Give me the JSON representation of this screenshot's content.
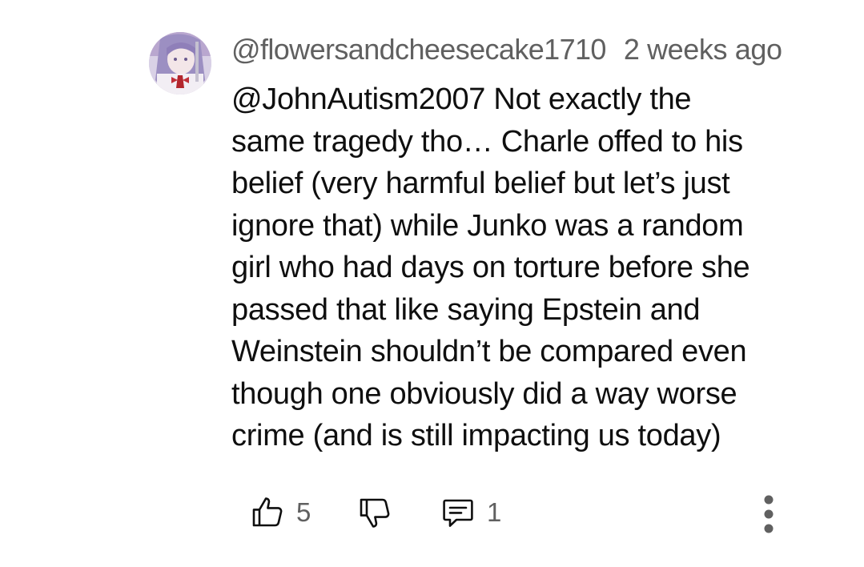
{
  "comment": {
    "author_handle": "@flowersandcheesecake1710",
    "timestamp": "2 weeks ago",
    "text_lines": [
      "@JohnAutism2007 Not exactly the",
      "same tragedy tho… Charle offed to his",
      "belief (very harmful belief but let’s just",
      "ignore that) while Junko was a random",
      "girl who had days on torture before she",
      "passed that like saying Epstein and",
      "Weinstein shouldn’t be compared even",
      "though one obviously did a way worse",
      "crime (and is still impacting us today)"
    ]
  },
  "actions": {
    "like_count": "5",
    "reply_count": "1",
    "like_icon": "thumbs-up-icon",
    "dislike_icon": "thumbs-down-icon",
    "reply_icon": "comment-icon",
    "more_icon": "more-vertical-icon"
  },
  "colors": {
    "text": "#0f0f0f",
    "secondary_text": "#606060",
    "icon": "#0f0f0f",
    "background": "#ffffff"
  }
}
